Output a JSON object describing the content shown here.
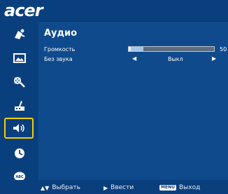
{
  "brand": "acer",
  "menu": {
    "title": "Аудио",
    "volume": {
      "label": "Громкость",
      "value": "50",
      "level": 0.17
    },
    "mute": {
      "label": "Без звука",
      "value": "Выкл"
    }
  },
  "sidebar": {
    "items": [
      {
        "icon": "color-icon"
      },
      {
        "icon": "image-icon"
      },
      {
        "icon": "settings-icon"
      },
      {
        "icon": "management-icon"
      },
      {
        "icon": "audio-icon",
        "selected": true
      },
      {
        "icon": "timer-icon"
      },
      {
        "icon": "language-icon"
      }
    ]
  },
  "footer": {
    "select": {
      "key": "▲▼",
      "label": "Выбрать"
    },
    "enter": {
      "key": "▶",
      "label": "Ввести"
    },
    "exit": {
      "key": "MENU",
      "label": "Выход"
    }
  },
  "colors": {
    "background": "#0f4a8c",
    "panel": "#0a3f7d",
    "selection": "#f1d000",
    "bar_fill": "#a8c5e3"
  }
}
